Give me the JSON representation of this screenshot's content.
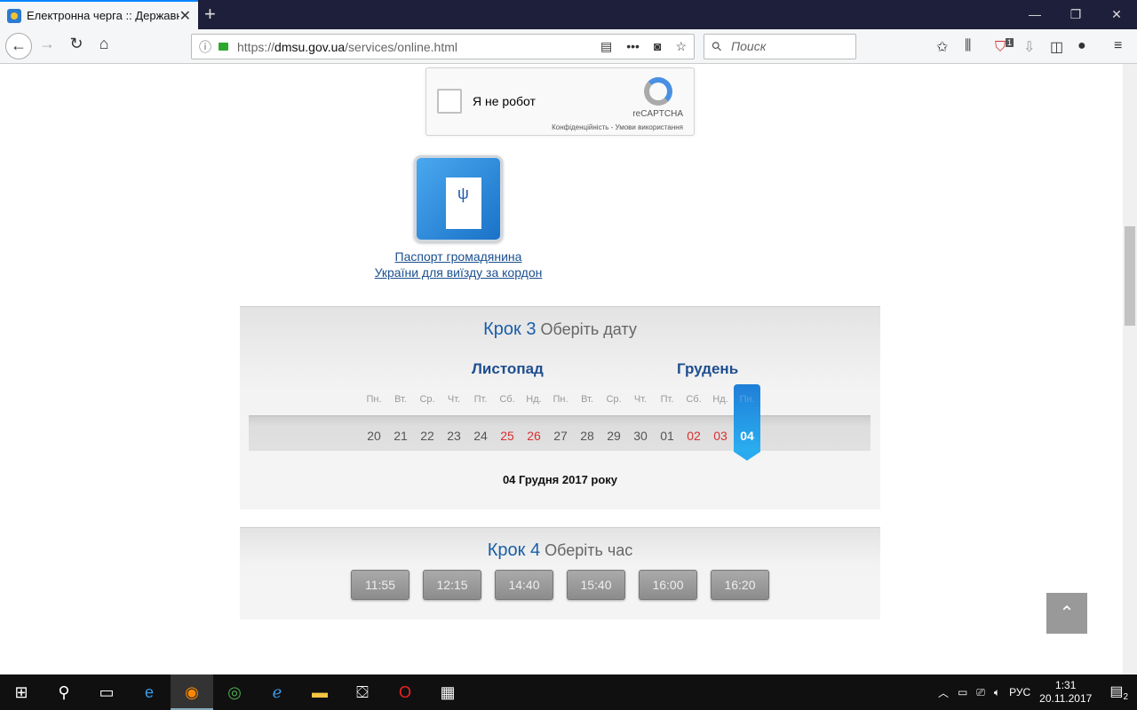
{
  "browser": {
    "tab_title": "Електронна черга :: Державна",
    "url_prefix": "https://",
    "url_domain": "dmsu.gov.ua",
    "url_path": "/services/online.html",
    "search_placeholder": "Поиск",
    "badge": "1"
  },
  "captcha": {
    "label": "Я не робот",
    "brand": "reCAPTCHA",
    "terms": "Конфіденційність - Умови використання"
  },
  "service": {
    "line1": "Паспорт громадянина",
    "line2": "України для виїзду за кордон"
  },
  "step3": {
    "step": "Крок 3",
    "title": "Оберіть дату",
    "months": [
      "Листопад",
      "Грудень"
    ],
    "days": [
      {
        "dn": "Пн.",
        "d": "20"
      },
      {
        "dn": "Вт.",
        "d": "21"
      },
      {
        "dn": "Ср.",
        "d": "22"
      },
      {
        "dn": "Чт.",
        "d": "23"
      },
      {
        "dn": "Пт.",
        "d": "24"
      },
      {
        "dn": "Сб.",
        "d": "25",
        "weekend": true
      },
      {
        "dn": "Нд.",
        "d": "26",
        "weekend": true
      },
      {
        "dn": "Пн.",
        "d": "27"
      },
      {
        "dn": "Вт.",
        "d": "28"
      },
      {
        "dn": "Ср.",
        "d": "29"
      },
      {
        "dn": "Чт.",
        "d": "30"
      },
      {
        "dn": "Пт.",
        "d": "01"
      },
      {
        "dn": "Сб.",
        "d": "02",
        "weekend": true
      },
      {
        "dn": "Нд.",
        "d": "03",
        "weekend": true
      },
      {
        "dn": "Пн.",
        "d": "04",
        "selected": true
      }
    ],
    "selected_date": "04 Грудня 2017 року"
  },
  "step4": {
    "step": "Крок 4",
    "title": "Оберіть час",
    "times": [
      "11:55",
      "12:15",
      "14:40",
      "15:40",
      "16:00",
      "16:20"
    ]
  },
  "taskbar": {
    "lang": "РУС",
    "time": "1:31",
    "date": "20.11.2017",
    "notifications": "2"
  }
}
